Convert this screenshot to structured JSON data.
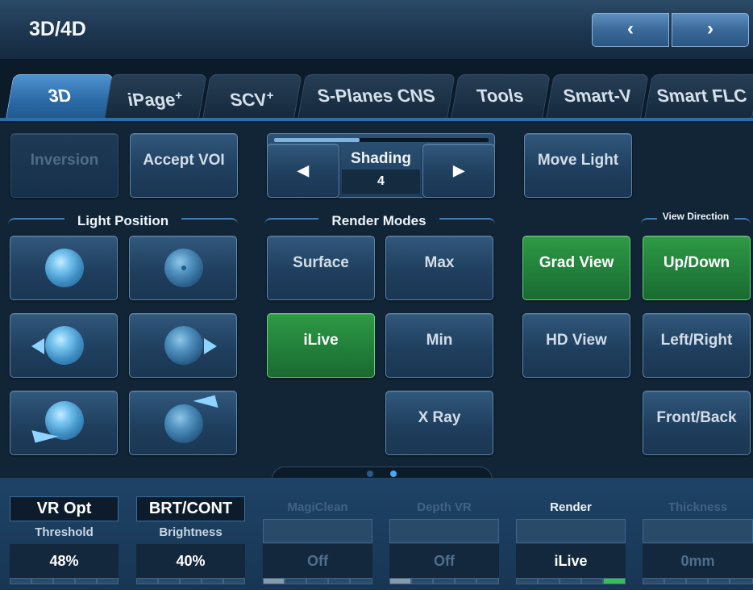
{
  "header": {
    "title": "3D/4D",
    "prev_icon": "‹",
    "next_icon": "›"
  },
  "tabs": [
    {
      "label": "3D",
      "sup": "",
      "active": true
    },
    {
      "label": "iPage",
      "sup": "+",
      "active": false
    },
    {
      "label": "SCV",
      "sup": "+",
      "active": false
    },
    {
      "label": "S-Planes CNS",
      "sup": "",
      "active": false
    },
    {
      "label": "Tools",
      "sup": "",
      "active": false
    },
    {
      "label": "Smart-V",
      "sup": "",
      "active": false
    },
    {
      "label": "Smart FLC",
      "sup": "",
      "active": false
    }
  ],
  "top_buttons": {
    "inversion": "Inversion",
    "accept_voi": "Accept VOI",
    "move_light": "Move Light"
  },
  "shading": {
    "label": "Shading",
    "value": "4",
    "slider_fraction": 0.4,
    "left_arrow": "◀",
    "right_arrow": "▶"
  },
  "light_position": {
    "label": "Light Position"
  },
  "render_modes": {
    "label": "Render Modes",
    "surface": "Surface",
    "max": "Max",
    "ilive": "iLive",
    "min": "Min",
    "xray": "X Ray"
  },
  "views": {
    "grad_view": "Grad View",
    "hd_view": "HD View"
  },
  "view_direction": {
    "label": "View Direction",
    "up_down": "Up/Down",
    "left_right": "Left/Right",
    "front_back": "Front/Back"
  },
  "pager": {
    "pages": 2,
    "active_page": 2
  },
  "colors": {
    "accent_blue": "#2c6ea8",
    "active_green": "#21803a",
    "tab_active": "#2b6aa6"
  },
  "bottom": {
    "vr_opt": "VR Opt",
    "brt_cont": "BRT/CONT",
    "threshold": {
      "title": "Threshold",
      "value": "48%"
    },
    "brightness": {
      "title": "Brightness",
      "value": "40%"
    },
    "magiclean": {
      "title": "MagiClean",
      "value": "Off"
    },
    "depth_vr": {
      "title": "Depth VR",
      "value": "Off"
    },
    "render": {
      "title": "Render",
      "value": "iLive"
    },
    "thickness": {
      "title": "Thickness",
      "value": "0mm"
    }
  }
}
